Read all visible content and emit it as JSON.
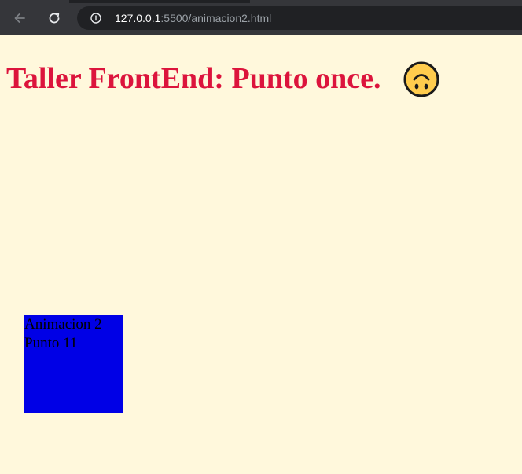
{
  "browser": {
    "url_host": "127.0.0.1",
    "url_rest": ":5500/animacion2.html"
  },
  "page": {
    "title": "Taller FrontEnd: Punto once.",
    "emoji_icon": "upside-down-face-icon",
    "box": {
      "line1": "Animacion 2",
      "line2": "Punto 11"
    }
  },
  "colors": {
    "background": "#fff8dc",
    "title": "#dc143c",
    "box": "#0000e6"
  }
}
